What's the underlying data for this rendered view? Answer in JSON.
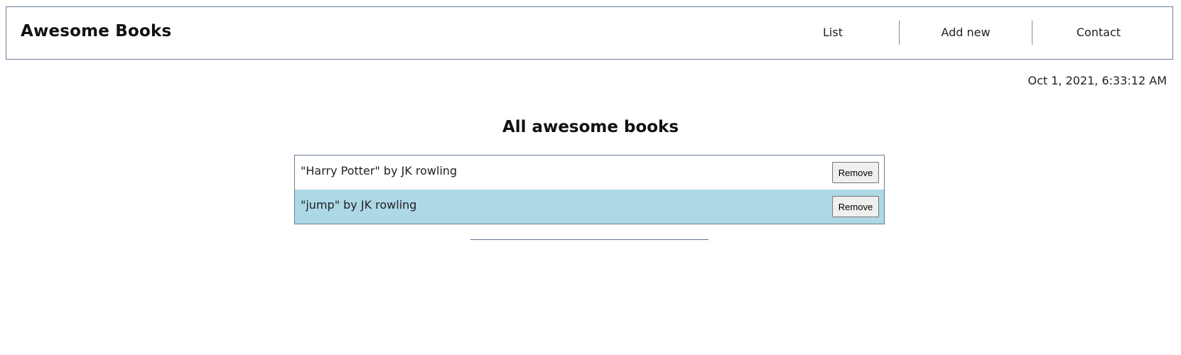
{
  "app": {
    "brand": "Awesome Books"
  },
  "nav": {
    "items": [
      {
        "label": "List"
      },
      {
        "label": "Add new"
      },
      {
        "label": "Contact"
      }
    ]
  },
  "date_text": "Oct 1, 2021, 6:33:12 AM",
  "main": {
    "title": "All awesome books",
    "books": [
      {
        "text": "\"Harry Potter\" by JK rowling",
        "remove_label": "Remove"
      },
      {
        "text": "\"jump\" by JK rowling",
        "remove_label": "Remove"
      }
    ]
  },
  "colors": {
    "border": "#6b7d95",
    "alt_row": "#add8e6",
    "button_bg": "#efefef"
  }
}
